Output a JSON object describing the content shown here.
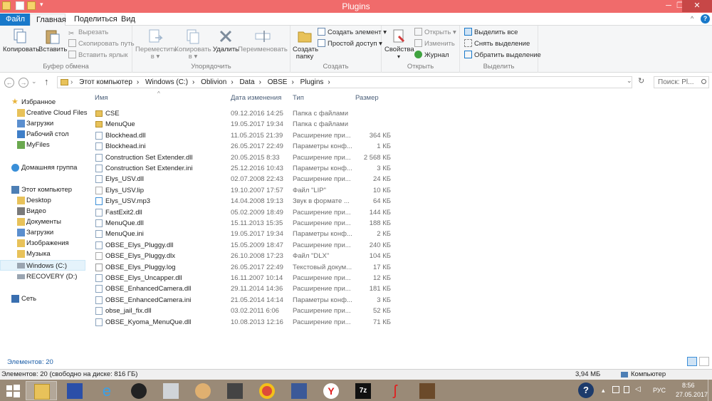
{
  "window": {
    "title": "Plugins",
    "minimize": "─",
    "maximize": "❐",
    "close": "✕",
    "help": "?",
    "collapse": "^"
  },
  "tabs": [
    {
      "label": "Файл"
    },
    {
      "label": "Главная"
    },
    {
      "label": "Поделиться"
    },
    {
      "label": "Вид"
    }
  ],
  "ribbon": {
    "clipboard": {
      "label": "Буфер обмена",
      "copy": "Копировать",
      "paste": "Вставить",
      "cut": "Вырезать",
      "copy_path": "Скопировать путь",
      "paste_shortcut": "Вставить ярлык"
    },
    "organize": {
      "label": "Упорядочить",
      "move_to": "Переместить",
      "copy_to": "Копировать",
      "to_suffix": "в ▾",
      "delete": "Удалить",
      "rename": "Переименовать"
    },
    "create": {
      "label": "Создать",
      "new_folder": "Создать папку",
      "new_item": "Создать элемент ▾",
      "easy_access": "Простой доступ ▾"
    },
    "open": {
      "label": "Открыть",
      "properties": "Свойства",
      "open": "Открыть ▾",
      "edit": "Изменить",
      "history": "Журнал"
    },
    "select": {
      "label": "Выделить",
      "select_all": "Выделить все",
      "select_none": "Снять выделение",
      "invert": "Обратить выделение"
    }
  },
  "address": {
    "back": "←",
    "forward": "→",
    "recent": "⌄",
    "up": "↑",
    "crumbs": [
      "Этот компьютер",
      "Windows (C:)",
      "Oblivion",
      "Data",
      "OBSE",
      "Plugins"
    ],
    "separator": "›",
    "dropdown": "⌄",
    "refresh": "↻",
    "search_placeholder": "Поиск: Pl..."
  },
  "nav": {
    "favorites": "Избранное",
    "fav_items": [
      "Creative Cloud Files",
      "Загрузки",
      "Рабочий стол",
      "MyFiles"
    ],
    "homegroup": "Домашняя группа",
    "computer": "Этот компьютер",
    "computer_items": [
      "Desktop",
      "Видео",
      "Документы",
      "Загрузки",
      "Изображения",
      "Музыка",
      "Windows (C:)",
      "RECOVERY (D:)"
    ],
    "network": "Сеть"
  },
  "columns": {
    "name": "Имя",
    "date": "Дата изменения",
    "type": "Тип",
    "size": "Размер"
  },
  "files": [
    {
      "name": "CSE",
      "date": "09.12.2016 14:25",
      "type": "Папка с файлами",
      "size": "",
      "icon": "folder"
    },
    {
      "name": "MenuQue",
      "date": "19.05.2017 19:34",
      "type": "Папка с файлами",
      "size": "",
      "icon": "folder"
    },
    {
      "name": "Blockhead.dll",
      "date": "11.05.2015 21:39",
      "type": "Расширение при...",
      "size": "364 КБ",
      "icon": "dll"
    },
    {
      "name": "Blockhead.ini",
      "date": "26.05.2017 22:49",
      "type": "Параметры конф...",
      "size": "1 КБ",
      "icon": "ini"
    },
    {
      "name": "Construction Set Extender.dll",
      "date": "20.05.2015 8:33",
      "type": "Расширение при...",
      "size": "2 568 КБ",
      "icon": "dll"
    },
    {
      "name": "Construction Set Extender.ini",
      "date": "25.12.2016 10:43",
      "type": "Параметры конф...",
      "size": "3 КБ",
      "icon": "ini"
    },
    {
      "name": "Elys_USV.dll",
      "date": "02.07.2008 22:43",
      "type": "Расширение при...",
      "size": "24 КБ",
      "icon": "dll"
    },
    {
      "name": "Elys_USV.lip",
      "date": "19.10.2007 17:57",
      "type": "Файл \"LIP\"",
      "size": "10 КБ",
      "icon": "file"
    },
    {
      "name": "Elys_USV.mp3",
      "date": "14.04.2008 19:13",
      "type": "Звук в формате ...",
      "size": "64 КБ",
      "icon": "mp3"
    },
    {
      "name": "FastExit2.dll",
      "date": "05.02.2009 18:49",
      "type": "Расширение при...",
      "size": "144 КБ",
      "icon": "dll"
    },
    {
      "name": "MenuQue.dll",
      "date": "15.11.2013 15:35",
      "type": "Расширение при...",
      "size": "188 КБ",
      "icon": "dll"
    },
    {
      "name": "MenuQue.ini",
      "date": "19.05.2017 19:34",
      "type": "Параметры конф...",
      "size": "2 КБ",
      "icon": "ini"
    },
    {
      "name": "OBSE_Elys_Pluggy.dll",
      "date": "15.05.2009 18:47",
      "type": "Расширение при...",
      "size": "240 КБ",
      "icon": "dll"
    },
    {
      "name": "OBSE_Elys_Pluggy.dlx",
      "date": "26.10.2008 17:23",
      "type": "Файл \"DLX\"",
      "size": "104 КБ",
      "icon": "file"
    },
    {
      "name": "OBSE_Elys_Pluggy.log",
      "date": "26.05.2017 22:49",
      "type": "Текстовый докум...",
      "size": "17 КБ",
      "icon": "txt"
    },
    {
      "name": "OBSE_Elys_Uncapper.dll",
      "date": "16.11.2007 10:14",
      "type": "Расширение при...",
      "size": "12 КБ",
      "icon": "dll"
    },
    {
      "name": "OBSE_EnhancedCamera.dll",
      "date": "29.11.2014 14:36",
      "type": "Расширение при...",
      "size": "181 КБ",
      "icon": "dll"
    },
    {
      "name": "OBSE_EnhancedCamera.ini",
      "date": "21.05.2014 14:14",
      "type": "Параметры конф...",
      "size": "3 КБ",
      "icon": "ini"
    },
    {
      "name": "obse_jail_fix.dll",
      "date": "03.02.2011 6:06",
      "type": "Расширение при...",
      "size": "52 КБ",
      "icon": "dll"
    },
    {
      "name": "OBSE_Kyoma_MenuQue.dll",
      "date": "10.08.2013 12:16",
      "type": "Расширение при...",
      "size": "71 КБ",
      "icon": "dll"
    }
  ],
  "status": {
    "items_count": "Элементов: 20"
  },
  "details": {
    "left": "Элементов: 20 (свободно на диске: 816 ГБ)",
    "size": "3,94 МБ",
    "location": "Компьютер"
  },
  "taskbar": {
    "lang": "РУС",
    "time": "8:56",
    "date": "27.05.2017"
  },
  "colors": {
    "titlebar": "#f06b6b",
    "accent": "#1979ca",
    "folder": "#e8c25a",
    "taskbar": "#9a8a77"
  }
}
